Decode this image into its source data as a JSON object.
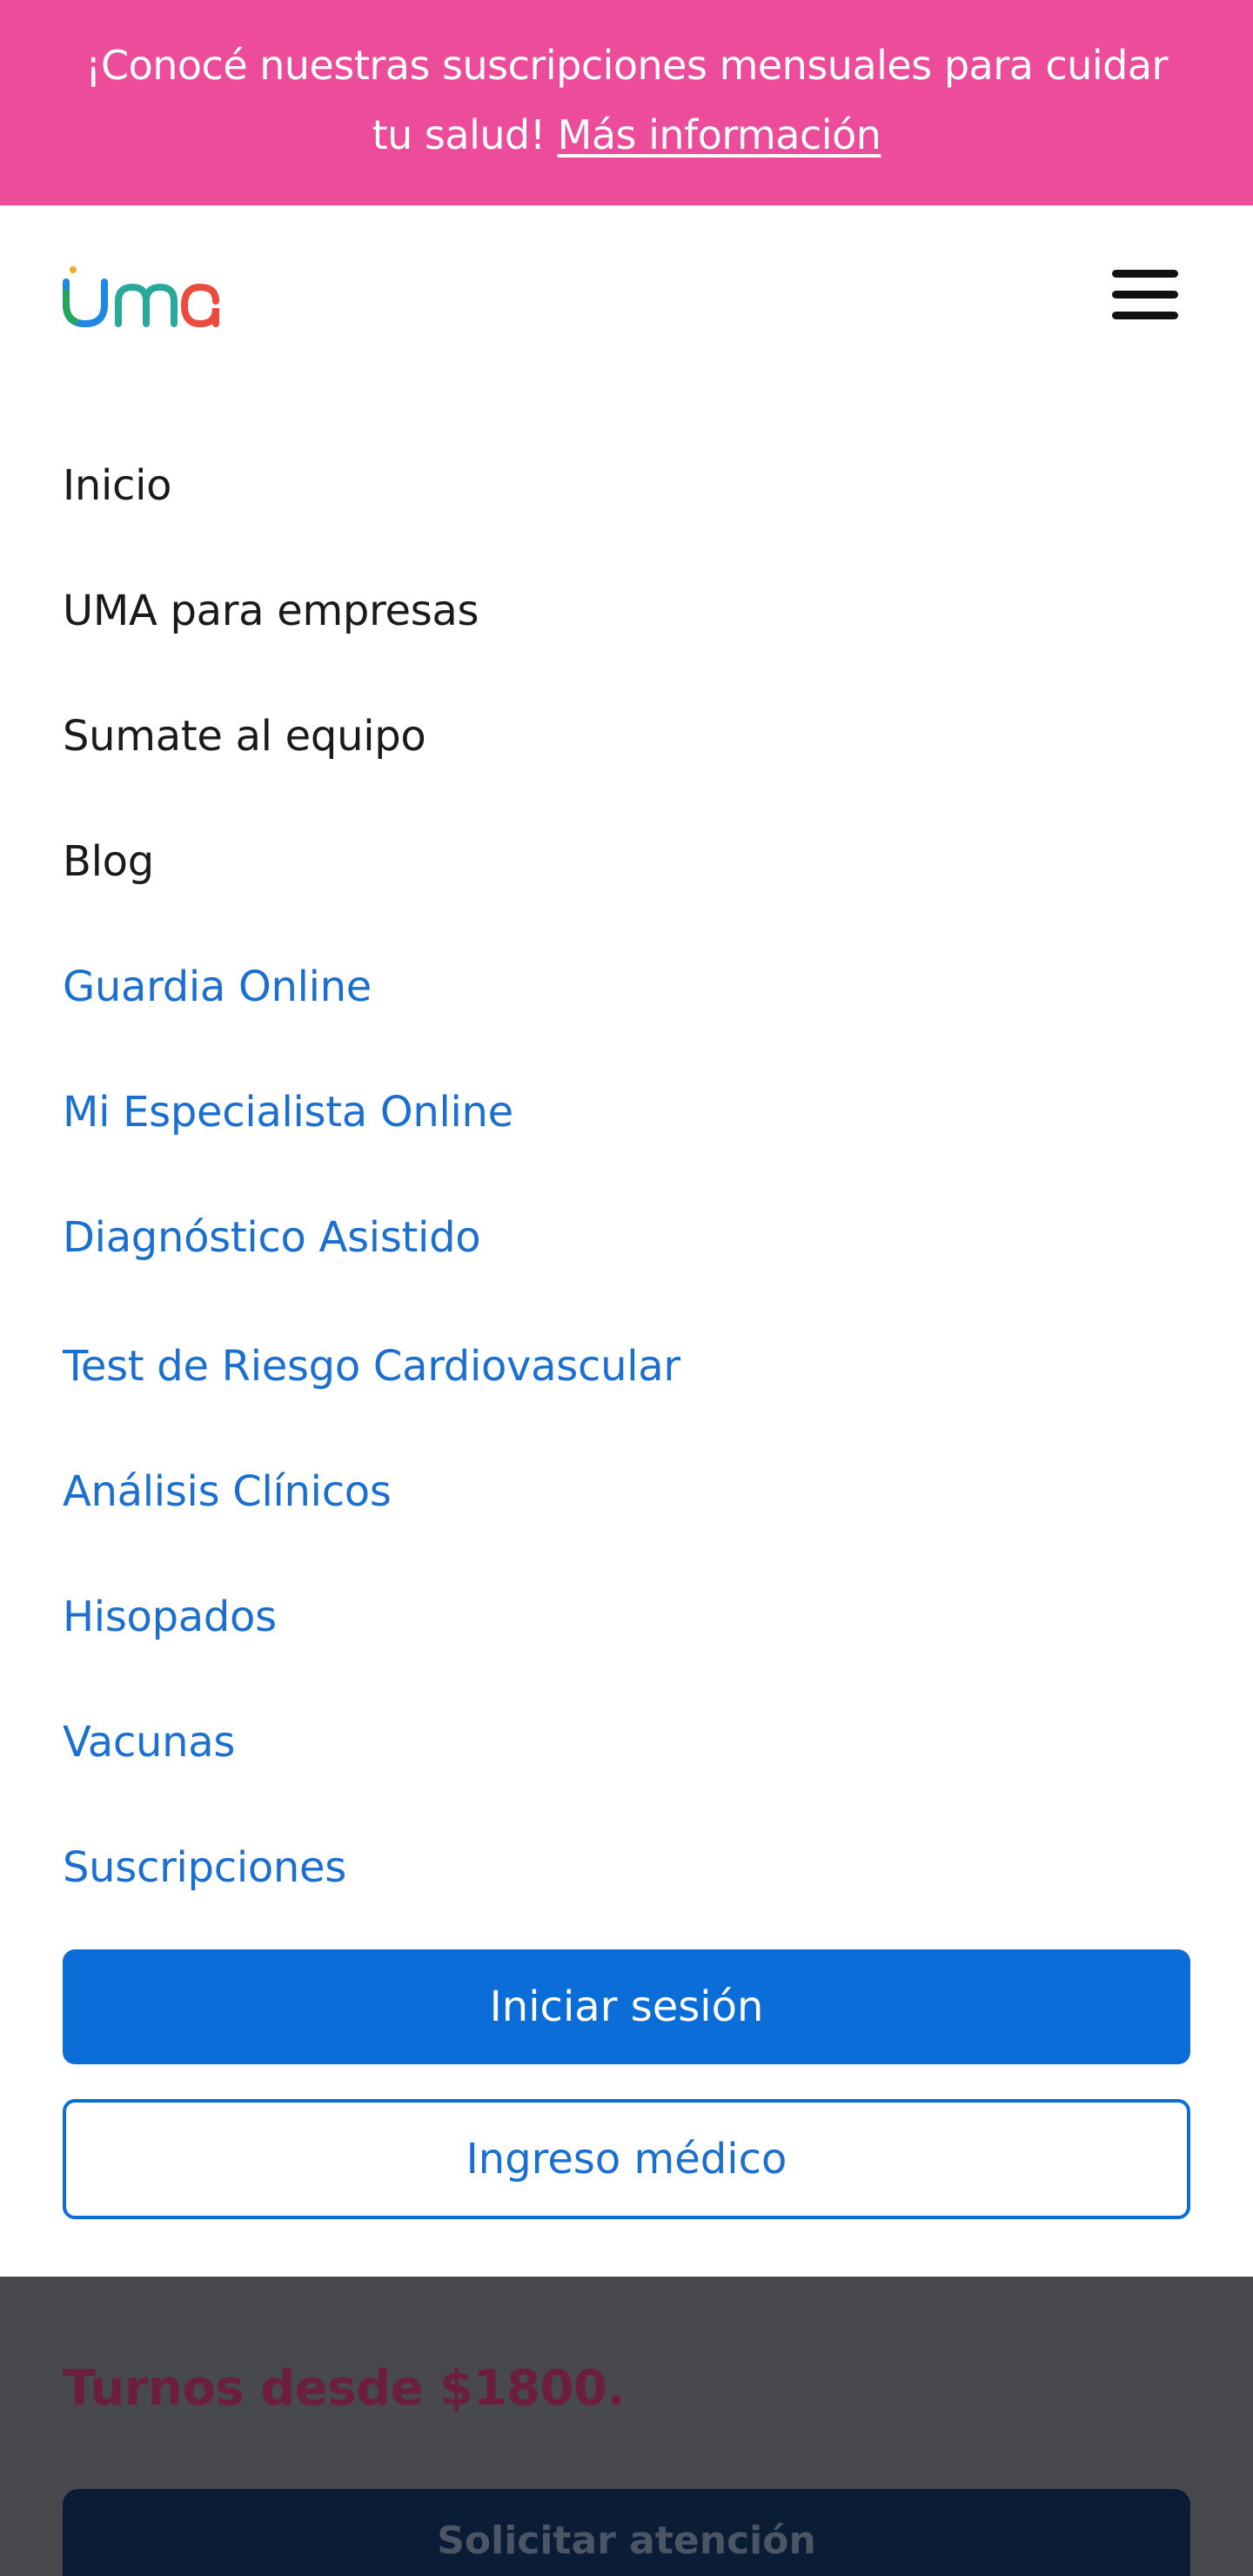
{
  "banner": {
    "text": "¡Conocé nuestras suscripciones mensuales para cuidar",
    "text_line2": "tu salud!",
    "link": "Más información",
    "background": "#ec4c9a"
  },
  "header": {
    "logo_text": "uma",
    "menu_icon": "hamburger-icon"
  },
  "menu": {
    "items": [
      {
        "label": "Inicio"
      },
      {
        "label": "UMA para empresas"
      },
      {
        "label": "Sumate al equipo"
      },
      {
        "label": "Blog"
      },
      {
        "label": "Guardia Online"
      },
      {
        "label": "Mi Especialista Online"
      },
      {
        "label": "Diagnóstico Asistido"
      },
      {
        "label": "Test de Riesgo Cardiovascular"
      },
      {
        "label": "Análisis Clínicos"
      },
      {
        "label": "Hisopados"
      },
      {
        "label": "Vacunas"
      },
      {
        "label": "Suscripciones"
      }
    ],
    "login_button": "Iniciar sesión",
    "doctor_button": "Ingreso médico"
  },
  "background_page": {
    "price_text": "Turnos desde $1800.",
    "cta": "Solicitar atención"
  },
  "colors": {
    "accent_blue": "#0b6ed8",
    "link_blue": "#1a6fd1",
    "banner_pink": "#ec4c9a",
    "overlay": "#47494d"
  }
}
